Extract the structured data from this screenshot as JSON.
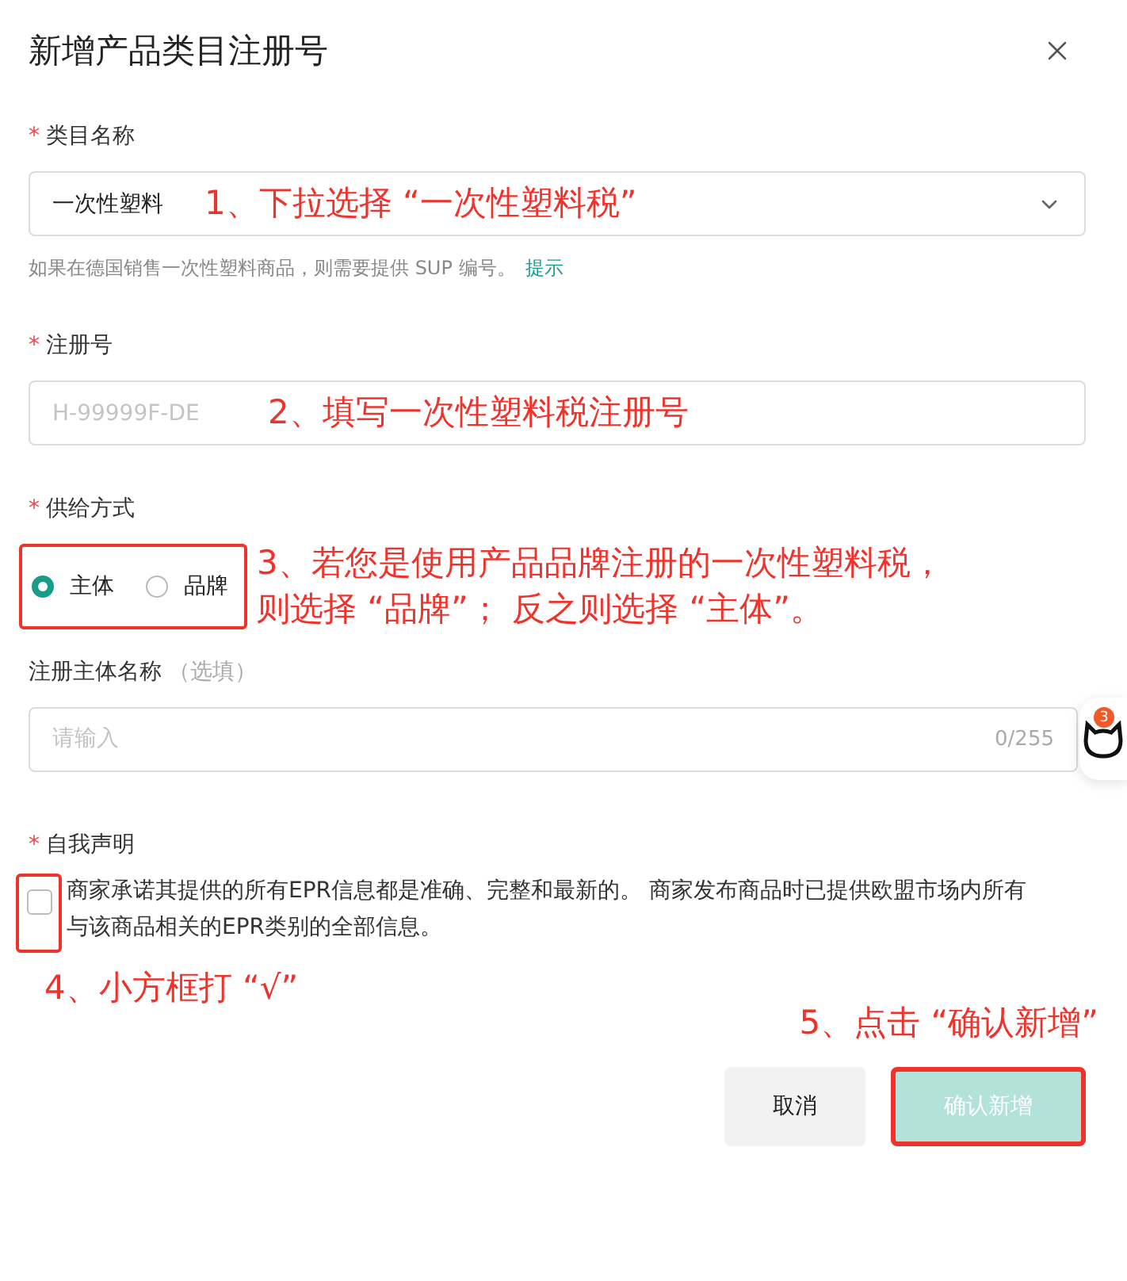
{
  "dialog": {
    "title": "新增产品类目注册号"
  },
  "category": {
    "label": "类目名称",
    "required_mark": "*",
    "value": "一次性塑料",
    "hint": "如果在德国销售一次性塑料商品，则需要提供 SUP 编号。",
    "hint_link": "提示",
    "annotation": "1、下拉选择 “一次性塑料税”"
  },
  "registration": {
    "label": "注册号",
    "required_mark": "*",
    "placeholder": "H-99999F-DE",
    "annotation": "2、填写一次性塑料税注册号"
  },
  "supply": {
    "label": "供给方式",
    "required_mark": "*",
    "highlighted": true,
    "options": [
      {
        "label": "主体",
        "selected": true
      },
      {
        "label": "品牌",
        "selected": false
      }
    ],
    "annotation_lines": [
      "3、若您是使用产品品牌注册的一次性塑料税，",
      "则选择 “品牌”； 反之则选择 “主体”。"
    ]
  },
  "entity_name": {
    "label": "注册主体名称",
    "optional_note": "（选填）",
    "placeholder": "请输入",
    "counter": "0/255"
  },
  "floating_helper": {
    "badge": "3"
  },
  "declaration": {
    "label": "自我声明",
    "required_mark": "*",
    "checked": false,
    "highlighted": true,
    "text": "商家承诺其提供的所有EPR信息都是准确、完整和最新的。 商家发布商品时已提供欧盟市场内所有与该商品相关的EPR类别的全部信息。",
    "annotation": "4、小方框打 “√”"
  },
  "footer": {
    "annotation": "5、点击 “确认新增”",
    "cancel": "取消",
    "confirm": {
      "label": "确认新增",
      "disabled": true,
      "highlighted": true
    }
  }
}
